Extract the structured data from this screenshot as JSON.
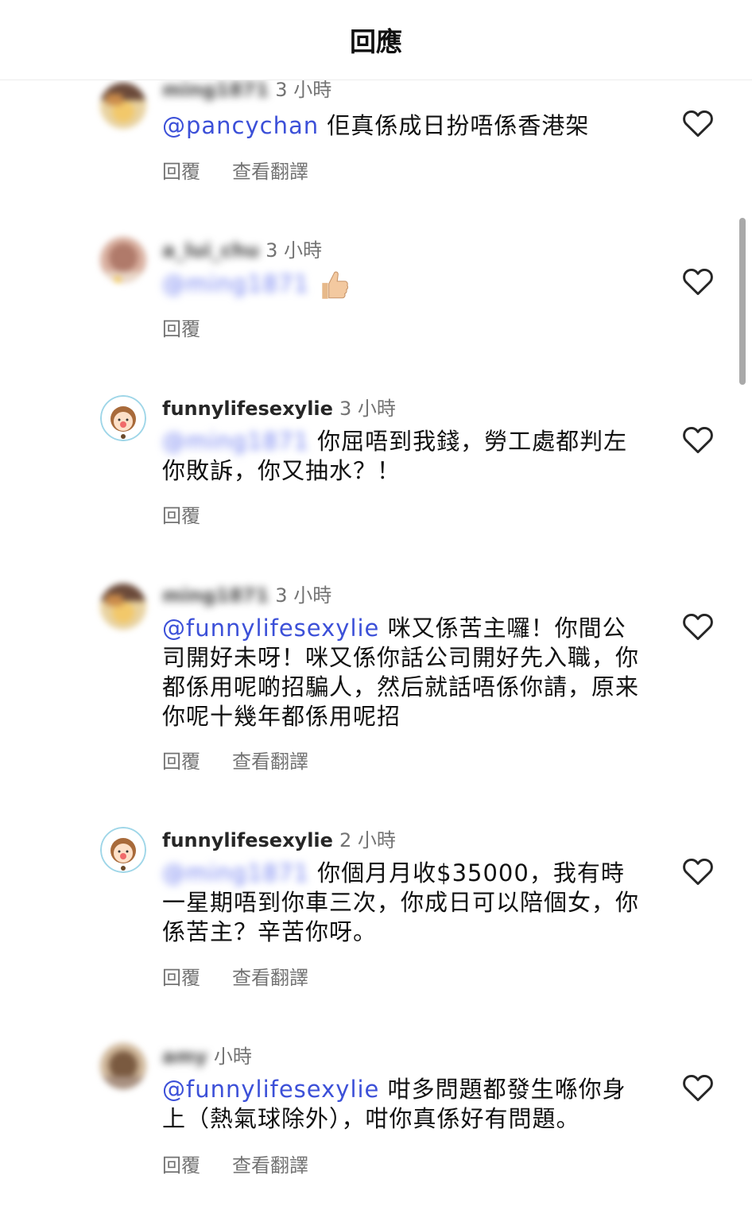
{
  "header": {
    "title": "回應"
  },
  "comments": [
    {
      "username": "ming1871",
      "time": "3 小時",
      "mention": "@pancychan",
      "text": " 佢真係成日扮唔係香港架",
      "reply_label": "回覆",
      "translate_label": "查看翻譯"
    },
    {
      "username": "a_lui_chu",
      "time": "3 小時",
      "mention": "@ming1871",
      "text": "",
      "reply_label": "回覆"
    },
    {
      "username": "funnylifesexylie",
      "time": "3 小時",
      "mention": "@ming1871",
      "text": " 你屈唔到我錢，勞工處都判左你敗訴，你又抽水？！",
      "reply_label": "回覆"
    },
    {
      "username": "ming1871",
      "time": "3 小時",
      "mention": "@funnylifesexylie",
      "text": " 咪又係苦主囉！你間公司開好未呀！咪又係你話公司開好先入職，你都係用呢啲招騙人，然后就話唔係你請，原来你呢十幾年都係用呢招",
      "reply_label": "回覆",
      "translate_label": "查看翻譯"
    },
    {
      "username": "funnylifesexylie",
      "time": "2 小時",
      "mention": "@ming1871",
      "text": " 你個月月收$35000，我有時一星期唔到你車三次，你成日可以陪個女，你係苦主？辛苦你呀。",
      "reply_label": "回覆",
      "translate_label": "查看翻譯"
    },
    {
      "username": "amy",
      "time": "小時",
      "mention": "@funnylifesexylie",
      "text": " 咁多問題都發生喺你身上（熱氣球除外），咁你真係好有問題。",
      "reply_label": "回覆",
      "translate_label": "查看翻譯"
    }
  ],
  "icons": {
    "heart": "heart-outline-icon",
    "thumbs": "thumbs-up-emoji-icon"
  },
  "colors": {
    "mention": "#3c50d8",
    "meta": "#737373"
  }
}
